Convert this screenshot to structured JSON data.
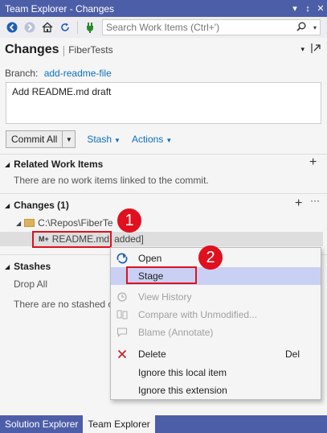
{
  "window": {
    "title": "Team Explorer - Changes",
    "controls": [
      "▾",
      "↕",
      "✕"
    ]
  },
  "toolbar": {
    "icons": [
      "back-icon",
      "forward-icon",
      "home-icon",
      "refresh-icon",
      "connect-icon"
    ],
    "search_placeholder": "Search Work Items (Ctrl+')"
  },
  "header": {
    "title": "Changes",
    "repo": "FiberTests"
  },
  "branch": {
    "label": "Branch:",
    "name": "add-readme-file"
  },
  "commit_message": "Add README.md draft",
  "actions": {
    "commit_label": "Commit All",
    "stash_label": "Stash",
    "actions_label": "Actions"
  },
  "related": {
    "title": "Related Work Items",
    "empty": "There are no work items linked to the commit."
  },
  "changes": {
    "title": "Changes (1)",
    "folder": "C:\\Repos\\FiberTe",
    "file_name": "README.md",
    "file_status": "added]",
    "file_icon": "M+"
  },
  "stashes": {
    "title": "Stashes",
    "drop_all": "Drop All",
    "empty": "There are no stashed c"
  },
  "context_menu": {
    "items": [
      {
        "label": "Open",
        "icon": "open-icon",
        "shortcut": ""
      },
      {
        "label": "Stage",
        "icon": "",
        "shortcut": ""
      },
      {
        "label": "View History",
        "icon": "history-icon",
        "shortcut": ""
      },
      {
        "label": "Compare with Unmodified...",
        "icon": "compare-icon",
        "shortcut": ""
      },
      {
        "label": "Blame (Annotate)",
        "icon": "blame-icon",
        "shortcut": ""
      },
      {
        "label": "Delete",
        "icon": "delete-icon",
        "shortcut": "Del"
      },
      {
        "label": "Ignore this local item",
        "icon": "",
        "shortcut": ""
      },
      {
        "label": "Ignore this extension",
        "icon": "",
        "shortcut": ""
      }
    ]
  },
  "callouts": [
    "1",
    "2"
  ],
  "bottom_tabs": [
    "Solution Explorer",
    "Team Explorer"
  ],
  "colors": {
    "accent": "#4d5ea8",
    "link": "#0e70c0",
    "callout": "#e0101e",
    "menu_hover": "#c9d0f3"
  }
}
